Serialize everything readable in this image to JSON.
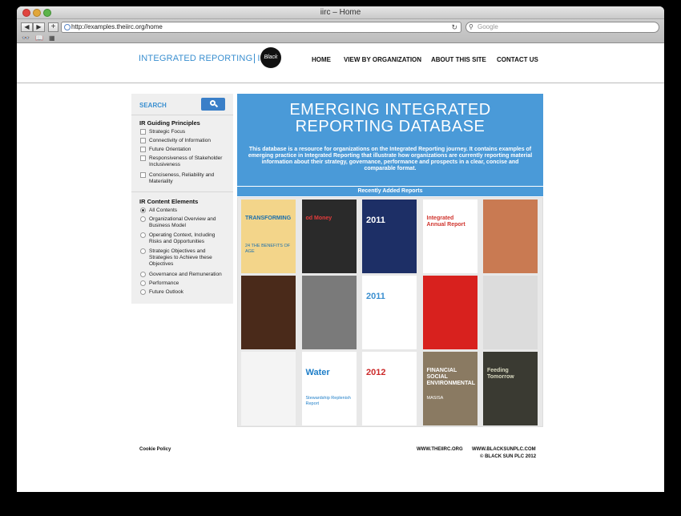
{
  "browser": {
    "window_title": "iirc – Home",
    "url": "http://examples.theiirc.org/home",
    "search_placeholder": "Google"
  },
  "header": {
    "logo_text": "INTEGRATED REPORTING",
    "logo_ir": "IR",
    "logo_badge": "Black Sun",
    "nav": [
      "HOME",
      "VIEW BY ORGANIZATION",
      "ABOUT THIS SITE",
      "CONTACT US"
    ]
  },
  "sidebar": {
    "search_label": "SEARCH",
    "guiding_heading": "IR Guiding Principles",
    "guiding_items": [
      "Strategic Focus",
      "Connectivity of Information",
      "Future Orientation",
      "Responsiveness of Stakeholder Inclusiveness",
      "Conciseness, Reliability and Materiality"
    ],
    "content_heading": "IR Content Elements",
    "content_items": [
      "All Contents",
      "Organizational Overview and Business Model",
      "Operating Context, Including Risks and Opportunities",
      "Strategic Objectives and Strategies to Achieve these Objectives",
      "Governance and Remuneration",
      "Performance",
      "Future Outlook"
    ],
    "selected_content_index": 0
  },
  "hero": {
    "title_line1": "EMERGING INTEGRATED",
    "title_line2": "REPORTING DATABASE",
    "description": "This database is a resource for organizations on the Integrated Reporting journey. It contains examples of emerging practice in Integrated Reporting that illustrate how organizations are currently reporting material information about their strategy, governance, performance and prospects in a clear, concise and comparable format."
  },
  "recent": {
    "label": "Recently Added Reports",
    "covers": [
      {
        "text": "TRANSFORMING",
        "sub": "24 THE BENEFITS OF AGE",
        "bg": "#f3d58a",
        "fg": "#1b6fae"
      },
      {
        "text": "od Money",
        "sub": "",
        "bg": "#2a2a2a",
        "fg": "#e33b3b"
      },
      {
        "text": "2011",
        "sub": "",
        "bg": "#1d2f66",
        "fg": "#ffffff"
      },
      {
        "text": "Integrated Annual Report",
        "sub": "",
        "bg": "#ffffff",
        "fg": "#d0352e"
      },
      {
        "text": "",
        "sub": "",
        "bg": "#c97a52",
        "fg": "#ffffff"
      },
      {
        "text": "",
        "sub": "",
        "bg": "#4a2a1a",
        "fg": "#ffffff"
      },
      {
        "text": "",
        "sub": "",
        "bg": "#7a7a7a",
        "fg": "#ffffff"
      },
      {
        "text": "2011",
        "sub": "",
        "bg": "#ffffff",
        "fg": "#3a8fd0"
      },
      {
        "text": "",
        "sub": "",
        "bg": "#d8211e",
        "fg": "#ffffff"
      },
      {
        "text": "",
        "sub": "",
        "bg": "#dcdcdc",
        "fg": "#333333"
      },
      {
        "text": "",
        "sub": "",
        "bg": "#f4f4f4",
        "fg": "#2c8c4a"
      },
      {
        "text": "Water",
        "sub": "Stewardship Replenish Report",
        "bg": "#ffffff",
        "fg": "#1e7ec8"
      },
      {
        "text": "2012",
        "sub": "",
        "bg": "#ffffff",
        "fg": "#cc2a2a"
      },
      {
        "text": "FINANCIAL SOCIAL ENVIRONMENTAL",
        "sub": "MASISA",
        "bg": "#8a7a62",
        "fg": "#ffffff"
      },
      {
        "text": "Feeding Tomorrow",
        "sub": "",
        "bg": "#3a3a32",
        "fg": "#d9d9c0"
      }
    ]
  },
  "footer": {
    "cookie": "Cookie Policy",
    "link1": "WWW.THEIIRC.ORG",
    "link2": "WWW.BLACKSUNPLC.COM",
    "copyright": "© BLACK SUN PLC 2012"
  }
}
